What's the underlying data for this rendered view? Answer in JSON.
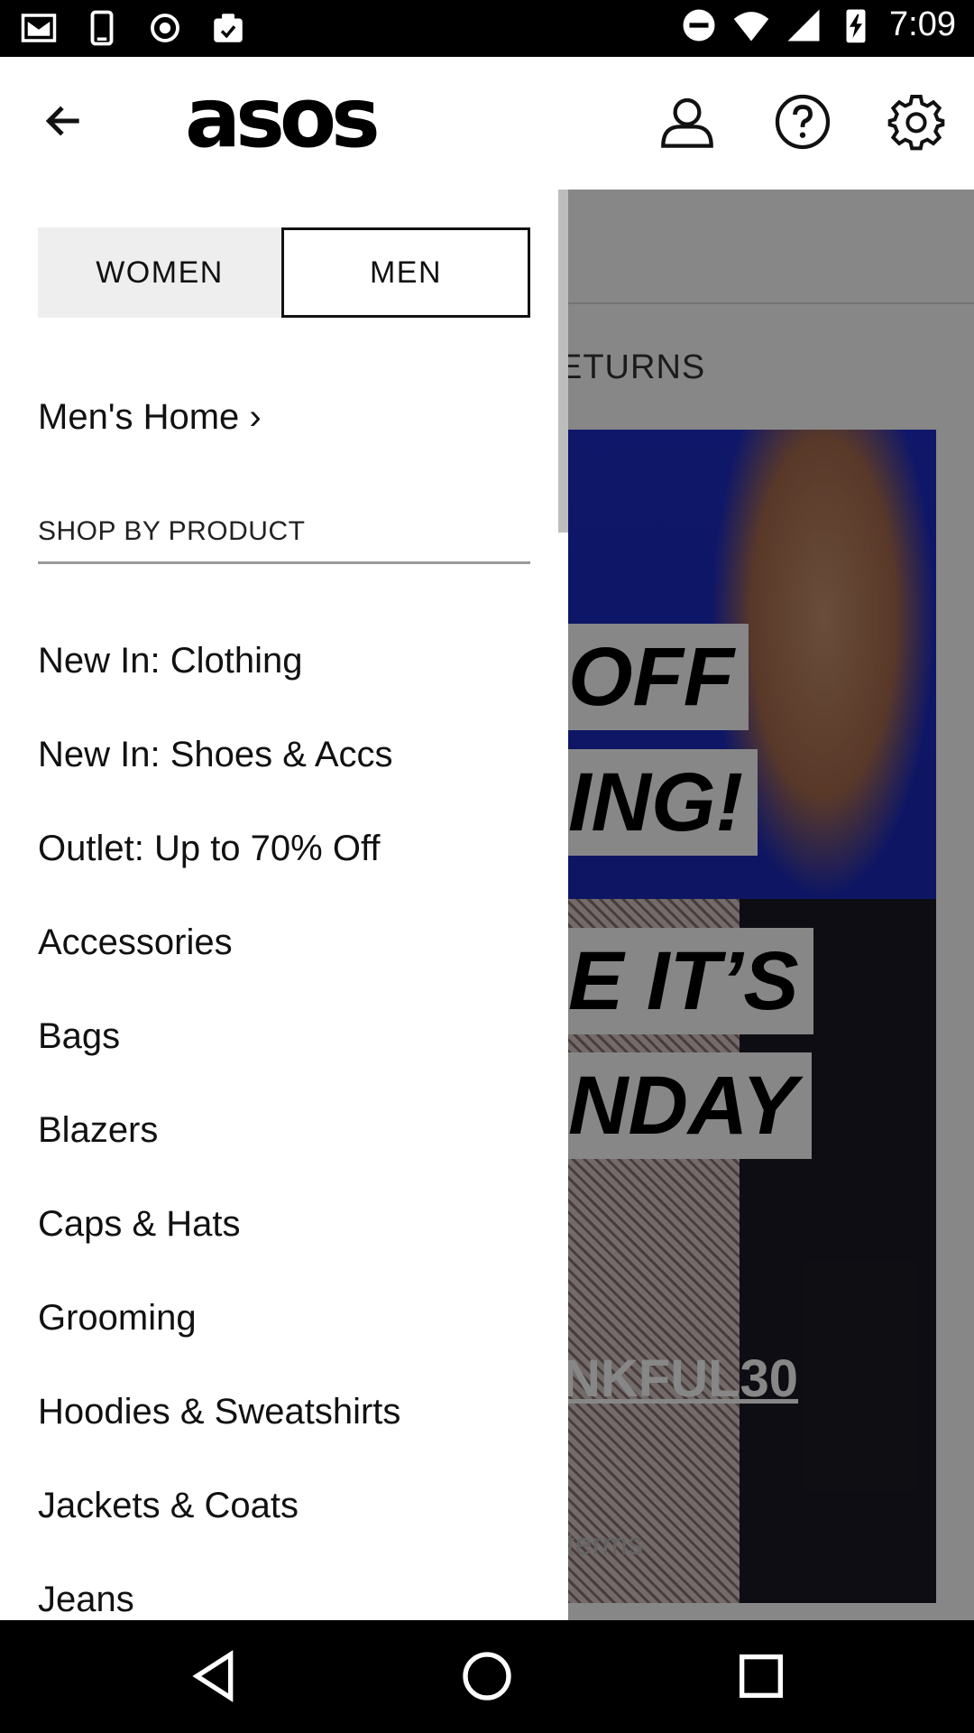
{
  "status_bar": {
    "time": "7:09",
    "icons": [
      "gmail-icon",
      "phone-icon",
      "record-icon",
      "clipboard-icon",
      "do-not-disturb-icon",
      "wifi-icon",
      "signal-icon",
      "battery-charging-icon"
    ]
  },
  "header": {
    "logo": "asos",
    "icons": [
      "back-arrow-icon",
      "account-icon",
      "help-icon",
      "settings-icon"
    ]
  },
  "drawer": {
    "gender_tabs": [
      {
        "label": "WOMEN",
        "selected": false
      },
      {
        "label": "MEN",
        "selected": true
      }
    ],
    "home_link": "Men's Home ›",
    "section_title": "SHOP BY PRODUCT",
    "items": [
      "New In: Clothing",
      "New In: Shoes & Accs",
      "Outlet: Up to 70% Off",
      "Accessories",
      "Bags",
      "Blazers",
      "Caps & Hats",
      "Grooming",
      "Hoodies & Sweatshirts",
      "Jackets & Coats",
      "Jeans"
    ]
  },
  "background": {
    "returns_fragment": "ETURNS",
    "promo_lines": [
      "OFF",
      "ING!",
      "E IT’S",
      "NDAY"
    ],
    "promo_code": "NKFUL30",
    "terms_fragment": "terms"
  },
  "nav_bar": {
    "icons": [
      "back-triangle-icon",
      "home-circle-icon",
      "recents-square-icon"
    ]
  },
  "colors": {
    "accent": "#000000",
    "tab_inactive_bg": "#eeeeee",
    "promo_blue": "#1d2cc8"
  }
}
